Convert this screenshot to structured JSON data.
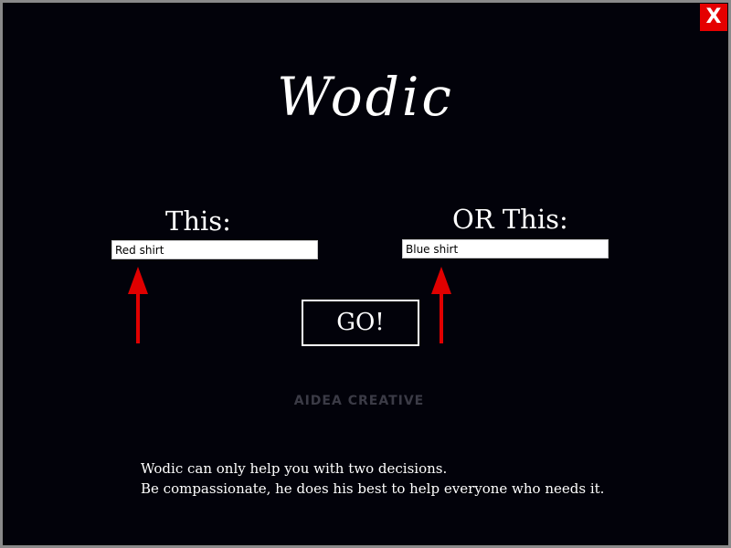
{
  "window": {
    "title": "Wodic",
    "close_label": "X"
  },
  "form": {
    "this_label": "This:",
    "this_value": "Red shirt",
    "or_this_label": "OR This:",
    "or_this_value": "Blue shirt",
    "go_label": "GO!"
  },
  "branding": {
    "text": "AIDEA CREATIVE"
  },
  "info": {
    "line1": "Wodic can only help you with two decisions.",
    "line2": "Be compassionate, he does his best to help everyone who needs it."
  },
  "icons": {
    "close": "close-icon",
    "arrow": "arrow-up-icon"
  },
  "colors": {
    "background": "#02020a",
    "close_button": "#e50000",
    "arrow": "#e00000",
    "brand_text": "#3b3b46",
    "text": "#ffffff"
  }
}
